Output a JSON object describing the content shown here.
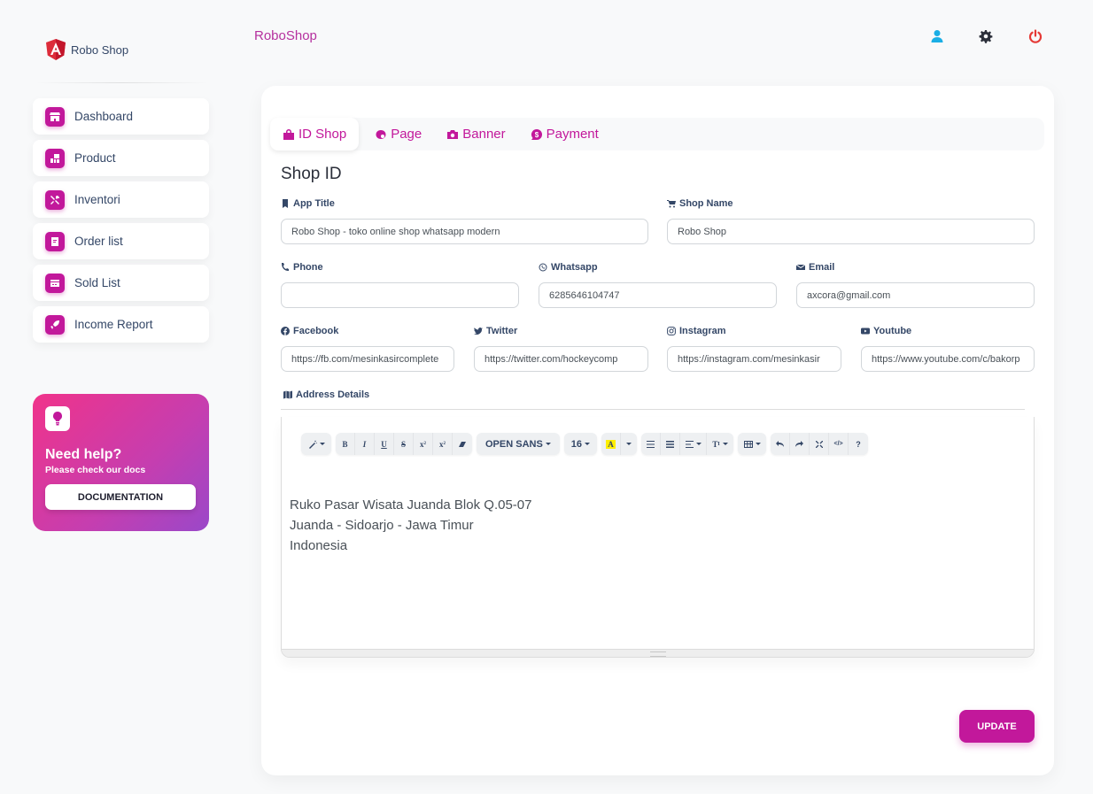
{
  "brand": {
    "name": "Robo Shop",
    "logo_icon": "angular-shield-icon"
  },
  "topbar": {
    "title": "RoboShop",
    "icons": [
      {
        "name": "user-icon",
        "color": "#1aaee5"
      },
      {
        "name": "gear-icon",
        "color": "#2b2f3a"
      },
      {
        "name": "power-icon",
        "color": "#e53935"
      }
    ]
  },
  "sidebar": {
    "items": [
      {
        "label": "Dashboard",
        "icon": "store-icon"
      },
      {
        "label": "Product",
        "icon": "chart-bar-icon"
      },
      {
        "label": "Inventori",
        "icon": "tools-icon"
      },
      {
        "label": "Order list",
        "icon": "document-icon"
      },
      {
        "label": "Sold List",
        "icon": "credit-card-icon"
      },
      {
        "label": "Income Report",
        "icon": "rocket-icon"
      }
    ],
    "help": {
      "title": "Need help?",
      "subtitle": "Please check our docs",
      "button": "DOCUMENTATION",
      "icon": "lightbulb-icon"
    }
  },
  "tabs": [
    {
      "label": "ID Shop",
      "icon": "shopping-bag-icon",
      "active": true
    },
    {
      "label": "Page",
      "icon": "page-icon",
      "active": false
    },
    {
      "label": "Banner",
      "icon": "camera-icon",
      "active": false
    },
    {
      "label": "Payment",
      "icon": "dollar-bubble-icon",
      "active": false
    }
  ],
  "form": {
    "title": "Shop ID",
    "app_title": {
      "label": "App Title",
      "value": "Robo Shop - toko online shop whatsapp modern"
    },
    "shop_name": {
      "label": "Shop Name",
      "value": "Robo Shop"
    },
    "phone": {
      "label": "Phone",
      "value": ""
    },
    "whatsapp": {
      "label": "Whatsapp",
      "value": "6285646104747"
    },
    "email": {
      "label": "Email",
      "value": "axcora@gmail.com"
    },
    "facebook": {
      "label": "Facebook",
      "value": "https://fb.com/mesinkasircomplete"
    },
    "twitter": {
      "label": "Twitter",
      "value": "https://twitter.com/hockeycomp"
    },
    "instagram": {
      "label": "Instagram",
      "value": "https://instagram.com/mesinkasir"
    },
    "youtube": {
      "label": "Youtube",
      "value": "https://www.youtube.com/c/bakorp"
    },
    "address": {
      "label": "Address Details",
      "lines": [
        "Ruko Pasar Wisata Juanda Blok Q.05-07",
        "Juanda - Sidoarjo - Jawa Timur",
        "Indonesia"
      ]
    },
    "update_button": "UPDATE"
  },
  "editor_toolbar": {
    "style": "style-magic-icon",
    "bold": "B",
    "italic": "I",
    "underline": "U",
    "strike": "S",
    "superscript": "x",
    "subscript": "x",
    "clear": "eraser-icon",
    "font_name": "OPEN SANS",
    "font_size": "16",
    "color": "A",
    "help": "?",
    "codeview": "</>"
  }
}
